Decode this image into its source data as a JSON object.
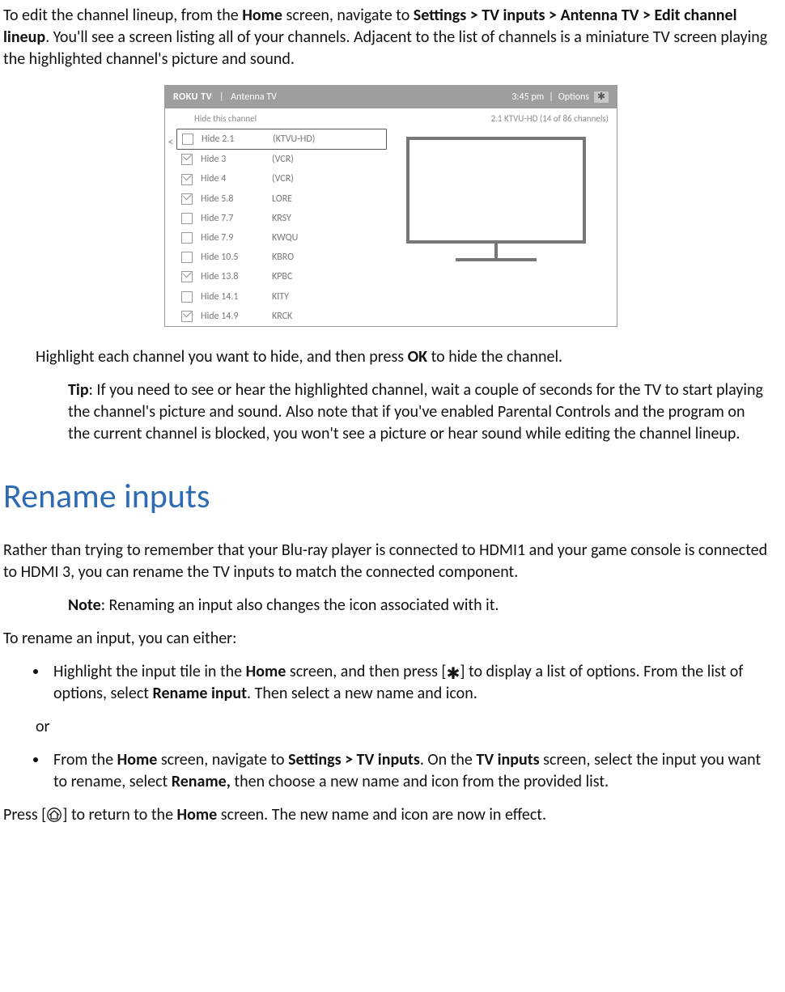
{
  "intro": {
    "p1a": "To edit the channel lineup, from the ",
    "home": "Home",
    "p1b": " screen, navigate to ",
    "path": "Settings > TV inputs > Antenna TV > Edit channel lineup",
    "p1c": ". You'll see a screen listing all of your channels. Adjacent to the list of channels is a miniature TV screen playing the highlighted channel's picture and sound."
  },
  "figure": {
    "brand": "ROKU TV",
    "breadcrumb": "Antenna TV",
    "time": "3:45 pm",
    "options": "Options",
    "hide_label": "Hide this channel",
    "current": "2.1 KTVU-HD (14 of 86 channels)",
    "rows": [
      {
        "checked": false,
        "hide": "Hide 2.1",
        "name": "(KTVU-HD)",
        "hl": true
      },
      {
        "checked": true,
        "hide": "Hide 3",
        "name": "(VCR)"
      },
      {
        "checked": true,
        "hide": "Hide 4",
        "name": "(VCR)"
      },
      {
        "checked": true,
        "hide": "Hide 5.8",
        "name": "LORE"
      },
      {
        "checked": false,
        "hide": "Hide 7.7",
        "name": "KRSY"
      },
      {
        "checked": false,
        "hide": "Hide 7.9",
        "name": "KWQU"
      },
      {
        "checked": false,
        "hide": "Hide 10.5",
        "name": "KBRO"
      },
      {
        "checked": true,
        "hide": "Hide 13.8",
        "name": "KPBC"
      },
      {
        "checked": false,
        "hide": "Hide 14.1",
        "name": "KITY"
      },
      {
        "checked": true,
        "hide": "Hide 14.9",
        "name": "KRCK"
      }
    ]
  },
  "highlight": {
    "a": "Highlight each channel you want to hide, and then press ",
    "ok": "OK",
    "b": " to hide the channel."
  },
  "tip": {
    "label": "Tip",
    "body": ": If you need to see or hear the highlighted channel, wait a couple of seconds for the TV to start playing the channel's picture and sound. Also note that if you've enabled Parental Controls and the program on the current channel is blocked, you won't see a picture or hear sound while editing the channel lineup."
  },
  "section": "Rename inputs",
  "rename_intro": "Rather than trying to remember that your Blu-ray player is connected to HDMI1 and your game console is connected to HDMI 3, you can rename the TV inputs to match the connected component.",
  "note": {
    "label": "Note",
    "body": ": Renaming an input also changes the icon associated with it."
  },
  "either": "To rename an input, you can either:",
  "bullet1": {
    "a": "Highlight the input tile in the ",
    "home": "Home",
    "b": " screen, and then press [",
    "c": "] to display a list of options. From the list of options, select ",
    "rename": "Rename input",
    "d": ". Then select a new name and icon."
  },
  "or": "or",
  "bullet2": {
    "a": "From the ",
    "home": "Home",
    "b": " screen, navigate to ",
    "path": "Settings > TV inputs",
    "c": ". On the ",
    "tv_inputs": "TV inputs",
    "d": " screen, select the input you want to rename, select ",
    "rename": "Rename,",
    "e": " then choose a new name and icon from the provided list."
  },
  "press": {
    "a": "Press [",
    "b": "] to return to the ",
    "home": "Home",
    "c": " screen. The new name and icon are now in effect."
  }
}
